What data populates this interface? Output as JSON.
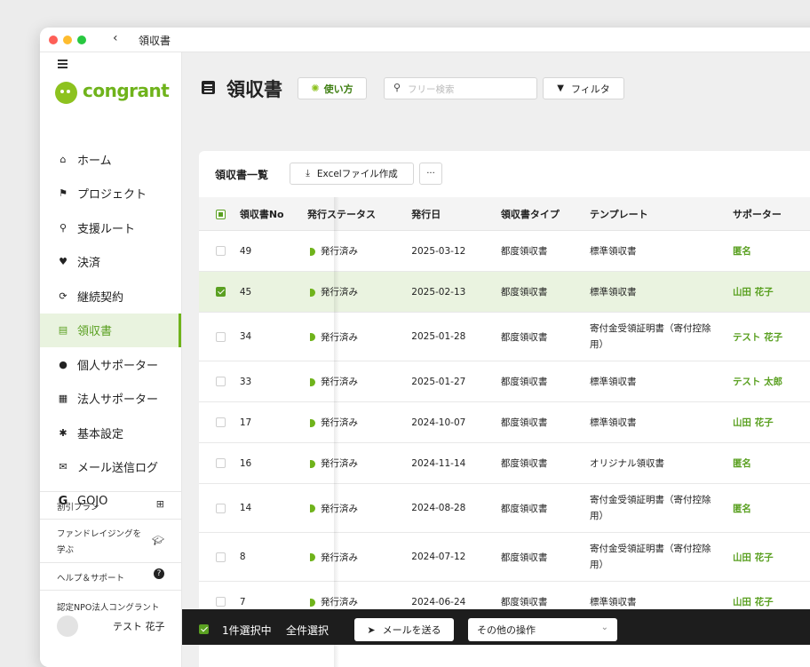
{
  "window": {
    "back_icon": "chevron-left-icon",
    "title": "領収書"
  },
  "brand": {
    "logo_text": "congrant",
    "color": "#6fb31b"
  },
  "sidebar": {
    "items": [
      {
        "label": "ホーム",
        "icon": "home-icon",
        "glyph": "⌂"
      },
      {
        "label": "プロジェクト",
        "icon": "flag-icon",
        "glyph": "⚑"
      },
      {
        "label": "支援ルート",
        "icon": "pin-icon",
        "glyph": "⚲"
      },
      {
        "label": "決済",
        "icon": "heart-icon",
        "glyph": "♥"
      },
      {
        "label": "継続契約",
        "icon": "repeat-icon",
        "glyph": "⟳"
      },
      {
        "label": "領収書",
        "icon": "receipt-icon",
        "glyph": "▤"
      },
      {
        "label": "個人サポーター",
        "icon": "person-icon",
        "glyph": "●"
      },
      {
        "label": "法人サポーター",
        "icon": "building-icon",
        "glyph": "▦"
      },
      {
        "label": "基本設定",
        "icon": "gear-icon",
        "glyph": "✱"
      },
      {
        "label": "メール送信ログ",
        "icon": "mail-icon",
        "glyph": "✉"
      },
      {
        "label": "GOJO",
        "icon": "g-logo-icon",
        "glyph": "G"
      }
    ],
    "footer": {
      "plan": "割引プラン",
      "learn": "ファンドレイジングを学ぶ",
      "learn_line1": "ファンドレイジングを",
      "learn_line2": "学ぶ",
      "help": "ヘルプ＆サポート",
      "org": "認定NPO法人コングラント",
      "user": "テスト 花子"
    }
  },
  "header": {
    "title": "領収書",
    "help_label": "使い方",
    "search_placeholder": "フリー検索",
    "filter_label": "フィルタ"
  },
  "card": {
    "title": "領収書一覧",
    "excel_label": "Excelファイル作成",
    "more_label": "···"
  },
  "table": {
    "columns": [
      "領収書No",
      "発行ステータス",
      "発行日",
      "領収書タイプ",
      "テンプレート",
      "サポーター"
    ],
    "rows": [
      {
        "checked": false,
        "no": "49",
        "status": "発行済み",
        "date": "2025-03-12",
        "type": "都度領収書",
        "template": "標準領収書",
        "supporter": "匿名"
      },
      {
        "checked": true,
        "no": "45",
        "status": "発行済み",
        "date": "2025-02-13",
        "type": "都度領収書",
        "template": "標準領収書",
        "supporter": "山田 花子"
      },
      {
        "checked": false,
        "no": "34",
        "status": "発行済み",
        "date": "2025-01-28",
        "type": "都度領収書",
        "template": "寄付金受領証明書（寄付控除用）",
        "supporter": "テスト 花子"
      },
      {
        "checked": false,
        "no": "33",
        "status": "発行済み",
        "date": "2025-01-27",
        "type": "都度領収書",
        "template": "標準領収書",
        "supporter": "テスト 太郎"
      },
      {
        "checked": false,
        "no": "17",
        "status": "発行済み",
        "date": "2024-10-07",
        "type": "都度領収書",
        "template": "標準領収書",
        "supporter": "山田 花子"
      },
      {
        "checked": false,
        "no": "16",
        "status": "発行済み",
        "date": "2024-11-14",
        "type": "都度領収書",
        "template": "オリジナル領収書",
        "supporter": "匿名"
      },
      {
        "checked": false,
        "no": "14",
        "status": "発行済み",
        "date": "2024-08-28",
        "type": "都度領収書",
        "template": "寄付金受領証明書（寄付控除用）",
        "supporter": "匿名"
      },
      {
        "checked": false,
        "no": "8",
        "status": "発行済み",
        "date": "2024-07-12",
        "type": "都度領収書",
        "template": "寄付金受領証明書（寄付控除用）",
        "supporter": "山田 花子"
      },
      {
        "checked": false,
        "no": "7",
        "status": "発行済み",
        "date": "2024-06-24",
        "type": "都度領収書",
        "template": "標準領収書",
        "supporter": "山田 花子"
      }
    ]
  },
  "actionbar": {
    "selected_count": "1件選択中",
    "select_all": "全件選択",
    "mail_label": "メールを送る",
    "other_label": "その他の操作"
  }
}
